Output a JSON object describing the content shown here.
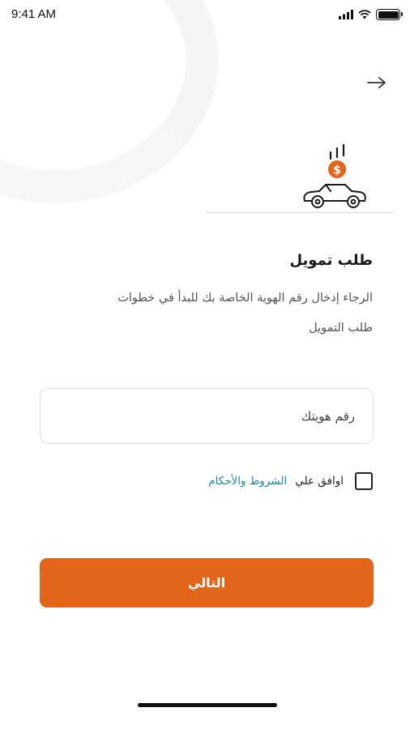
{
  "status_bar": {
    "time": "9:41 AM"
  },
  "header": {
    "back_icon": "arrow-right-icon"
  },
  "logo": {
    "icon": "car-finance-logo",
    "coin_symbol": "$",
    "accent_color": "#e2651a"
  },
  "main": {
    "title": "طلب تمويل",
    "instructions_line1": "الرجاء إدخال رقم الهوية الخاصة بك للبدأ في خطوات",
    "instructions_line2": "طلب التمويل",
    "id_field": {
      "placeholder": "رقم هويتك",
      "value": ""
    },
    "terms": {
      "checked": false,
      "text": "اوافق علي",
      "link_label": "الشروط والأحكام",
      "link_color": "#1f8a9c"
    },
    "next_button": {
      "label": "التالي",
      "color": "#e2651a"
    }
  }
}
